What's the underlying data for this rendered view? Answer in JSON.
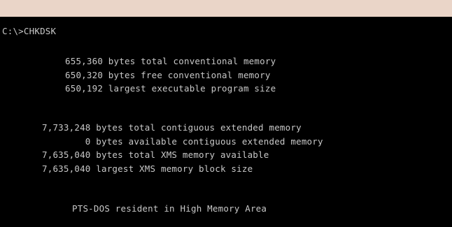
{
  "colors": {
    "screen_background": "#000000",
    "text": "#c8c8c8",
    "frame": "#ead5c8"
  },
  "terminal": {
    "prompt": "C:\\>CHKDSK",
    "conventional": [
      "655,360 bytes total conventional memory",
      "650,320 bytes free conventional memory",
      "650,192 largest executable program size"
    ],
    "extended": [
      "7,733,248 bytes total contiguous extended memory",
      "        0 bytes available contiguous extended memory",
      "7,635,040 bytes total XMS memory available",
      "7,635,040 largest XMS memory block size"
    ],
    "status": "PTS-DOS resident in High Memory Area"
  }
}
